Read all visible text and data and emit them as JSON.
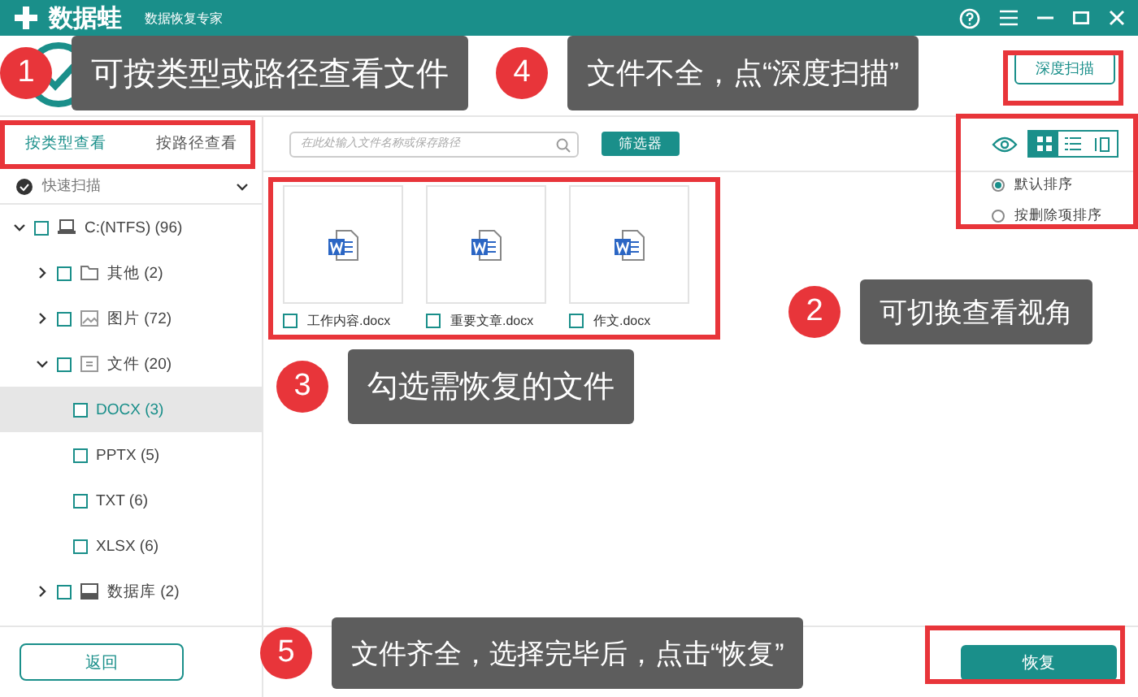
{
  "window": {
    "app_name": "数据蛙",
    "tagline": "数据恢复专家"
  },
  "deep_scan_button": "深度扫描",
  "view_tabs": [
    {
      "label": "按类型查看",
      "selected": true
    },
    {
      "label": "按路径查看",
      "selected": false
    }
  ],
  "scan_mode": "快速扫描",
  "tree": [
    {
      "label": "C:(NTFS) (96)",
      "kind": "drive",
      "expanded": true,
      "selected": false,
      "children": [
        {
          "label": "其他 (2)",
          "kind": "folder",
          "expanded": false,
          "selected": false
        },
        {
          "label": "图片 (72)",
          "kind": "image",
          "expanded": false,
          "selected": false
        },
        {
          "label": "文件 (20)",
          "kind": "document",
          "expanded": true,
          "selected": false,
          "children": [
            {
              "label": "DOCX (3)",
              "selected": true
            },
            {
              "label": "PPTX (5)",
              "selected": false
            },
            {
              "label": "TXT (6)",
              "selected": false
            },
            {
              "label": "XLSX (6)",
              "selected": false
            }
          ]
        },
        {
          "label": "数据库 (2)",
          "kind": "database",
          "expanded": false,
          "selected": false
        }
      ]
    }
  ],
  "back_button": "返回",
  "search": {
    "placeholder": "在此处输入文件名称或保存路径"
  },
  "filter_button": "筛选器",
  "view_modes": [
    {
      "kind": "grid",
      "selected": true
    },
    {
      "kind": "list",
      "selected": false
    },
    {
      "kind": "detail",
      "selected": false
    }
  ],
  "sort_options": [
    {
      "label": "默认排序",
      "selected": true
    },
    {
      "label": "按删除项排序",
      "selected": false
    }
  ],
  "files": [
    {
      "name": "工作内容.docx",
      "checked": false
    },
    {
      "name": "重要文章.docx",
      "checked": false
    },
    {
      "name": "作文.docx",
      "checked": false
    }
  ],
  "recover_button": "恢复",
  "callouts": [
    {
      "number": "1",
      "text": "可按类型或路径查看文件"
    },
    {
      "number": "4",
      "text": "文件不全，点“深度扫描”"
    },
    {
      "number": "2",
      "text": "可切换查看视角"
    },
    {
      "number": "3",
      "text": "勾选需恢复的文件"
    },
    {
      "number": "5",
      "text": "文件齐全，选择完毕后，点击“恢复”"
    }
  ]
}
